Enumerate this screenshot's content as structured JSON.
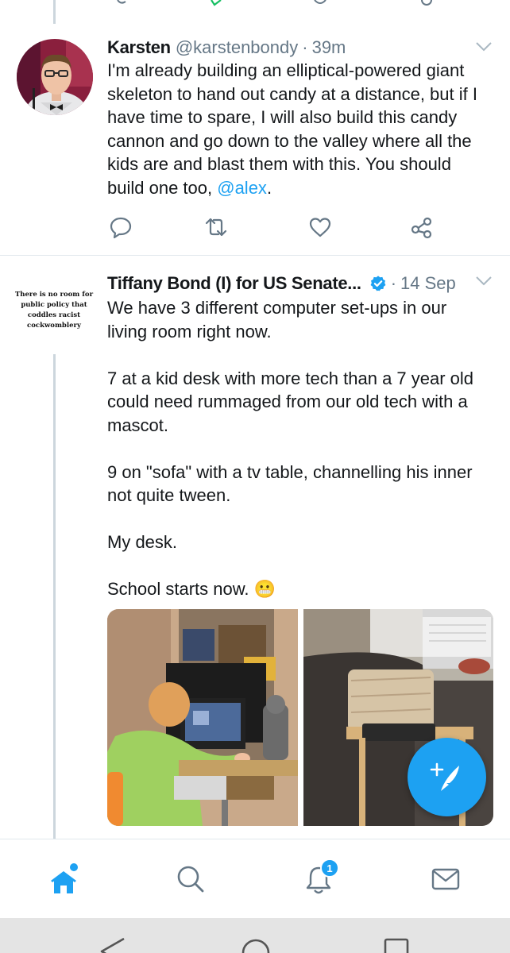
{
  "tweets": [
    {
      "display_name": "Karsten",
      "handle": "@karstenbondy",
      "separator": "·",
      "time": "39m",
      "text_before_mention": "I'm already building an elliptical-powered giant skeleton to hand out candy at a distance, but if I have time to spare, I will also build this candy cannon and go down to the valley where all the kids are and blast them with this. You should build one too, ",
      "mention": "@alex",
      "text_after_mention": ".",
      "actions": [
        "reply-icon",
        "retweet-icon",
        "like-icon",
        "share-icon"
      ]
    },
    {
      "display_name": "Tiffany Bond (I) for US Senate...",
      "verified": true,
      "separator": "·",
      "time": "14 Sep",
      "avatar_text": "There is no room for public policy that coddles racist cockwomblery",
      "paragraphs": [
        "We have 3 different computer set-ups in our living room right now.",
        "7 at a kid desk with more tech than a 7 year old could need rummaged from our old tech with a mascot.",
        "9 on \"sofa\" with a tv table, channelling his inner not quite tween.",
        "My desk.",
        "School starts now. 😬"
      ],
      "media_count": 2
    }
  ],
  "compose_button_icon": "compose-tweet-icon",
  "bottom_nav": {
    "items": [
      "home-icon",
      "search-icon",
      "notifications-icon",
      "messages-icon"
    ],
    "notification_count": "1"
  },
  "system_nav": [
    "back-icon",
    "home-circle-icon",
    "recents-icon"
  ],
  "colors": {
    "accent": "#1da1f2",
    "text": "#14171a",
    "secondary_text": "#657786",
    "divider": "#e1e8ed"
  }
}
